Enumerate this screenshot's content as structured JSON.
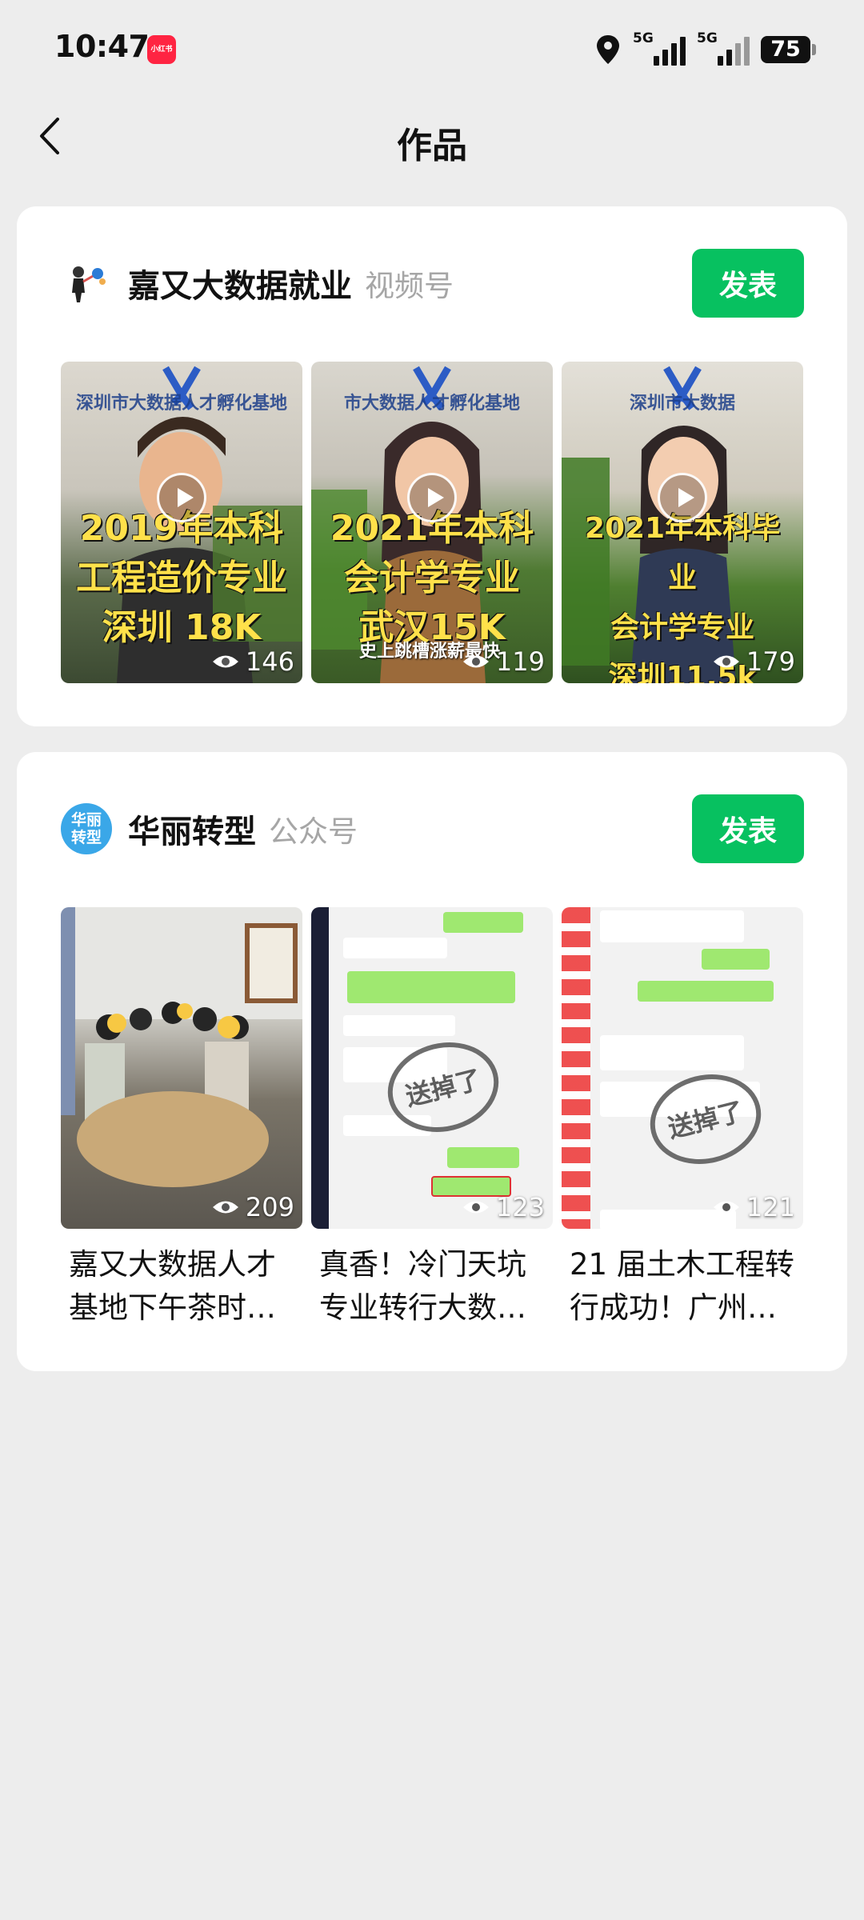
{
  "status_bar": {
    "time": "10:47",
    "app_badge": "小红书",
    "network_1": "5G",
    "network_2": "5G",
    "battery": "75"
  },
  "nav": {
    "title": "作品",
    "back_icon": "chevron-left-icon"
  },
  "accounts": [
    {
      "name": "嘉又大数据就业",
      "type": "视频号",
      "publish_label": "发表",
      "items": [
        {
          "caption": "2019年本科\n工程造价专业\n深圳 18K",
          "wall_text": "深圳市大数据人才孵化基地",
          "views": "146"
        },
        {
          "caption": "2021年本科\n会计学专业\n武汉15K",
          "wall_text": "市大数据人才孵化基地",
          "sub_caption": "史上跳槽涨薪最快",
          "views": "119"
        },
        {
          "caption": "2021年本科毕业\n会计学专业\n深圳11.5k",
          "wall_text": "深圳市大数据",
          "views": "179"
        }
      ]
    },
    {
      "name": "华丽转型",
      "type": "公众号",
      "avatar_text": "华丽转型",
      "publish_label": "发表",
      "items": [
        {
          "title": "嘉又大数据人才基地下午茶时…",
          "views": "209"
        },
        {
          "title": "真香！冷门天坑专业转行大数…",
          "views": "123",
          "stamp": "送掉了"
        },
        {
          "title": "21 届土木工程转行成功！广州…",
          "views": "121",
          "stamp": "送掉了"
        }
      ]
    }
  ],
  "colors": {
    "publish_green": "#07c160",
    "background": "#ededed",
    "card": "#ffffff",
    "muted_text": "#a6a6a6"
  }
}
